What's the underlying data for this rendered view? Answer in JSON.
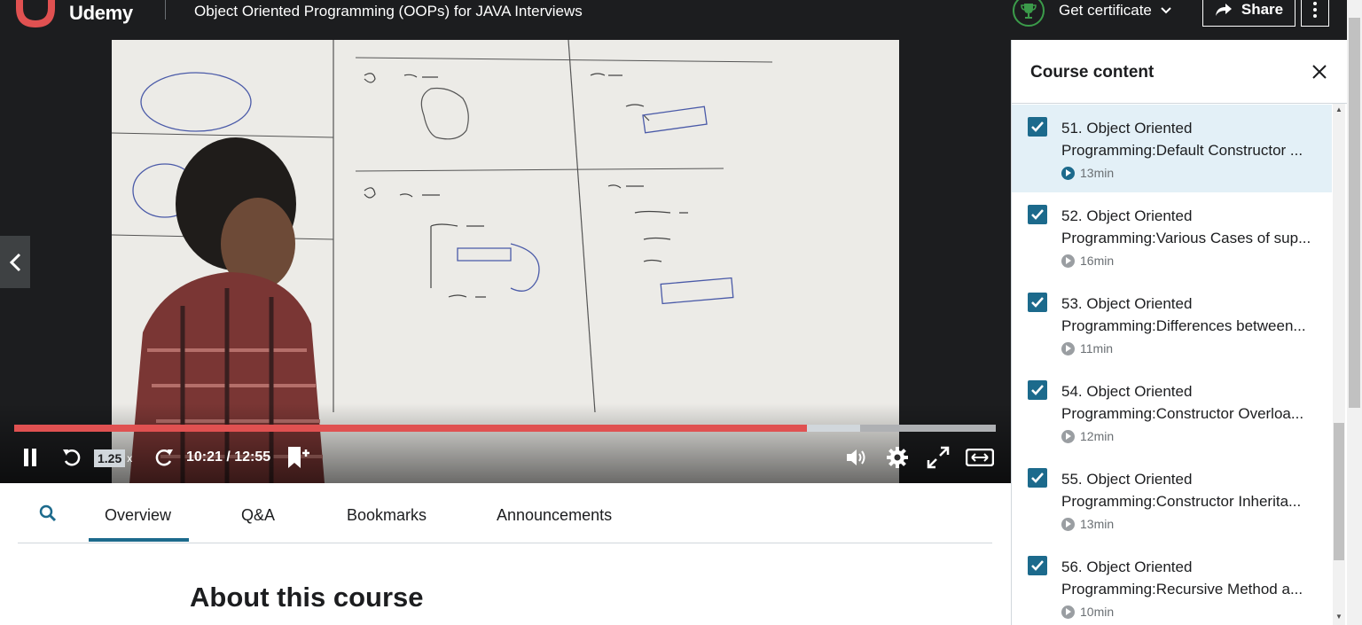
{
  "header": {
    "logo_text": "Udemy",
    "course_title": "Object Oriented Programming (OOPs) for JAVA Interviews",
    "certificate_label": "Get certificate",
    "share_label": "Share"
  },
  "player": {
    "speed": "1.25",
    "speed_suffix": "x",
    "timecode": "10:21 / 12:55",
    "progress_fraction": 0.808,
    "buffered_fraction": 0.862,
    "accent_color": "#e05151"
  },
  "tabs": {
    "items": [
      "Overview",
      "Q&A",
      "Bookmarks",
      "Announcements"
    ],
    "active": "Overview"
  },
  "main": {
    "section_heading": "About this course"
  },
  "sidebar": {
    "title": "Course content",
    "lessons": [
      {
        "title_line1": "51. Object Oriented",
        "title_line2": "Programming:Default Constructor ...",
        "duration": "13min",
        "completed": true,
        "current": true
      },
      {
        "title_line1": "52. Object Oriented",
        "title_line2": "Programming:Various Cases of sup...",
        "duration": "16min",
        "completed": true,
        "current": false
      },
      {
        "title_line1": "53. Object Oriented",
        "title_line2": "Programming:Differences between...",
        "duration": "11min",
        "completed": true,
        "current": false
      },
      {
        "title_line1": "54. Object Oriented",
        "title_line2": "Programming:Constructor Overloa...",
        "duration": "12min",
        "completed": true,
        "current": false
      },
      {
        "title_line1": "55. Object Oriented",
        "title_line2": "Programming:Constructor Inherita...",
        "duration": "13min",
        "completed": true,
        "current": false
      },
      {
        "title_line1": "56. Object Oriented",
        "title_line2": "Programming:Recursive Method a...",
        "duration": "10min",
        "completed": true,
        "current": false
      }
    ]
  },
  "icons": {
    "logo": "udemy-logo-icon",
    "certificate": "trophy-icon",
    "share": "share-arrow-icon",
    "more": "kebab-menu-icon",
    "prev": "chevron-left-icon",
    "pause": "pause-icon",
    "rewind": "rewind-5-icon",
    "forward": "forward-5-icon",
    "bookmark": "add-bookmark-icon",
    "volume": "volume-icon",
    "settings": "gear-icon",
    "fullscreen": "expand-icon",
    "theater": "theater-mode-icon",
    "search": "search-icon",
    "close": "close-icon",
    "check": "checkbox-checked-icon",
    "play": "play-circle-icon"
  }
}
